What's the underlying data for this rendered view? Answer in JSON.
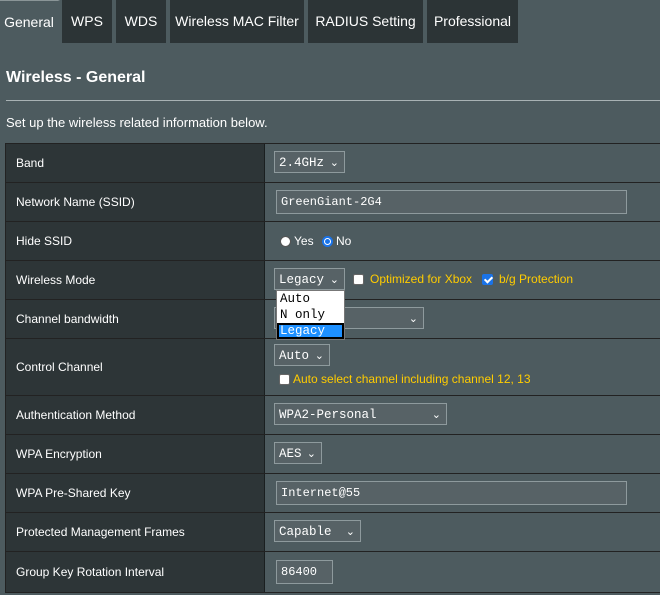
{
  "tabs": [
    "General",
    "WPS",
    "WDS",
    "Wireless MAC Filter",
    "RADIUS Setting",
    "Professional"
  ],
  "page_title": "Wireless - General",
  "intro": "Set up the wireless related information below.",
  "rows": {
    "band": {
      "label": "Band",
      "value": "2.4GHz"
    },
    "ssid": {
      "label": "Network Name (SSID)",
      "value": "GreenGiant-2G4"
    },
    "hide_ssid": {
      "label": "Hide SSID",
      "yes": "Yes",
      "no": "No",
      "selected": "No"
    },
    "wireless_mode": {
      "label": "Wireless Mode",
      "value": "Legacy",
      "xbox_label": "Optimized for Xbox",
      "xbox_checked": false,
      "bg_label": "b/g Protection",
      "bg_checked": true,
      "options": [
        "Auto",
        "N only",
        "Legacy"
      ]
    },
    "channel_bandwidth": {
      "label": "Channel bandwidth",
      "value": ""
    },
    "control_channel": {
      "label": "Control Channel",
      "value": "Auto",
      "auto_select_label": "Auto select channel including channel 12, 13",
      "auto_select_checked": false
    },
    "auth_method": {
      "label": "Authentication Method",
      "value": "WPA2-Personal"
    },
    "wpa_encryption": {
      "label": "WPA Encryption",
      "value": "AES"
    },
    "psk": {
      "label": "WPA Pre-Shared Key",
      "value": "Internet@55"
    },
    "pmf": {
      "label": "Protected Management Frames",
      "value": "Capable"
    },
    "group_key": {
      "label": "Group Key Rotation Interval",
      "value": "86400"
    }
  },
  "icons": {
    "select_arrow": "chevron-down-icon",
    "arrow_glyph": "⌄"
  },
  "colors": {
    "accent": "#1a73e8",
    "highlight_text": "#ffcc00",
    "page_bg": "#4d5b5f",
    "label_bg": "#2d3537"
  }
}
